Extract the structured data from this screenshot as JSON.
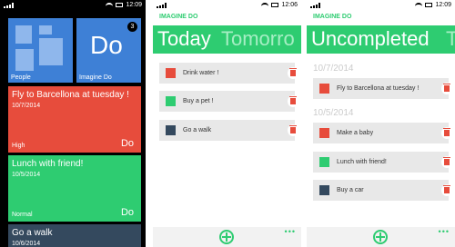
{
  "colors": {
    "accent": "#2ecc71",
    "red": "#e74c3c",
    "green": "#2ecc71",
    "dark": "#34495e",
    "blue": "#3e80d6"
  },
  "start": {
    "time": "12:09",
    "tiles": {
      "people_label": "People",
      "imagine": {
        "label": "Imagine Do",
        "big": "Do",
        "count": "3"
      },
      "tasks": [
        {
          "title": "Fly to Barcellona at tuesday !",
          "date": "10/7/2014",
          "priority": "High",
          "action": "Do"
        },
        {
          "title": "Lunch with friend!",
          "date": "10/5/2014",
          "priority": "Normal",
          "action": "Do"
        },
        {
          "title": "Go a walk",
          "date": "10/6/2014"
        }
      ]
    }
  },
  "today_screen": {
    "time": "12:06",
    "app_name": "IMAGINE DO",
    "pivot_current": "Today",
    "pivot_next": "Tomorro",
    "tasks": [
      {
        "label": "Drink water !",
        "color": "#e74c3c"
      },
      {
        "label": "Buy a pet !",
        "color": "#2ecc71"
      },
      {
        "label": "Go a walk",
        "color": "#34495e"
      }
    ],
    "more": "•••"
  },
  "uncompleted_screen": {
    "time": "12:09",
    "app_name": "IMAGINE DO",
    "pivot_current": "Uncompleted",
    "pivot_next": "T",
    "groups": [
      {
        "date": "10/7/2014",
        "tasks": [
          {
            "label": "Fly to Barcellona at tuesday !",
            "color": "#e74c3c"
          }
        ]
      },
      {
        "date": "10/5/2014",
        "tasks": [
          {
            "label": "Make a baby",
            "color": "#e74c3c"
          },
          {
            "label": "Lunch with friend!",
            "color": "#2ecc71"
          },
          {
            "label": "Buy a car",
            "color": "#34495e"
          }
        ]
      }
    ],
    "more": "•••"
  }
}
